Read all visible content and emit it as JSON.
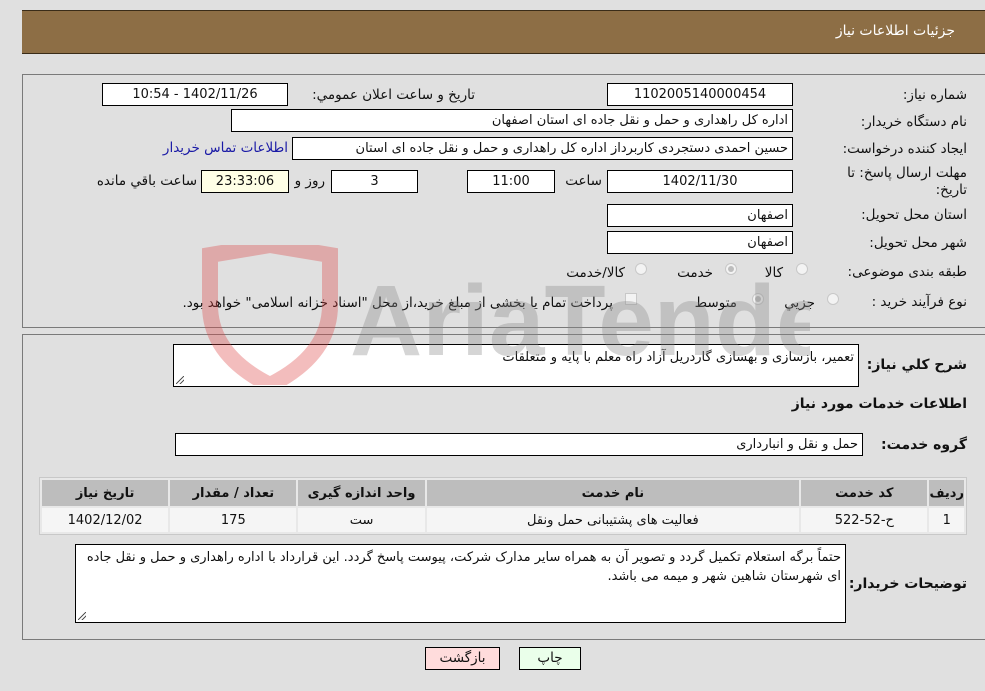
{
  "header": {
    "title": "جزئیات اطلاعات نیاز"
  },
  "info": {
    "need_number": {
      "label": "شماره نیاز:",
      "value": "1102005140000454"
    },
    "announce": {
      "label": "تاریخ و ساعت اعلان عمومي:",
      "value": "1402/11/26 - 10:54"
    },
    "buyer_org": {
      "label": "نام دستگاه خریدار:",
      "value": "اداره کل راهداری و حمل و نقل جاده ای استان اصفهان"
    },
    "creator": {
      "label": "ایجاد کننده درخواست:",
      "value": "حسین احمدی دستجردی کاربرداز اداره کل راهداری و حمل و نقل جاده ای استان",
      "contact_link": "اطلاعات تماس خریدار"
    },
    "deadline": {
      "label": "مهلت ارسال پاسخ: تا تاریخ:",
      "date": "1402/11/30",
      "time_label": "ساعت",
      "time": "11:00",
      "days": "3",
      "days_label": "روز و",
      "remaining": "23:33:06",
      "remaining_label": "ساعت باقي مانده"
    },
    "province": {
      "label": "استان محل تحویل:",
      "value": "اصفهان"
    },
    "city": {
      "label": "شهر محل تحویل:",
      "value": "اصفهان"
    },
    "category": {
      "label": "طبقه بندی موضوعی:",
      "options": [
        {
          "label": "کالا",
          "selected": false
        },
        {
          "label": "خدمت",
          "selected": true
        },
        {
          "label": "کالا/خدمت",
          "selected": false
        }
      ]
    },
    "process": {
      "label": "نوع فرآیند خرید :",
      "options": [
        {
          "label": "جزيي",
          "selected": false
        },
        {
          "label": "متوسط",
          "selected": true
        }
      ],
      "treasury_note": "پرداخت تمام یا بخشی از مبلغ خرید،از محل \"اسناد خزانه اسلامی\" خواهد بود.",
      "treasury_checked": false
    }
  },
  "details": {
    "description_label": "شرح کلي نیاز:",
    "description": "تعمیر، بازسازی و بهسازی گاردریل آزاد راه معلم با پایه و متعلقات",
    "services_title": "اطلاعات خدمات مورد نیاز",
    "service_group_label": "گروه خدمت:",
    "service_group": "حمل و نقل و انبارداری",
    "table": {
      "headers": [
        "ردیف",
        "کد خدمت",
        "نام خدمت",
        "واحد اندازه گیری",
        "تعداد / مقدار",
        "تاریخ نیاز"
      ],
      "rows": [
        [
          "1",
          "ح-52-522",
          "فعالیت های پشتیبانی حمل ونقل",
          "ست",
          "175",
          "1402/12/02"
        ]
      ]
    },
    "buyer_notes_label": "توضیحات خریدار:",
    "buyer_notes": "حتماً برگه استعلام تکمیل گردد و تصویر آن به همراه سایر مدارک شرکت، پیوست پاسخ گردد. این قرارداد با اداره راهداری و حمل و نقل جاده ای شهرستان شاهین شهر و میمه می باشد."
  },
  "buttons": {
    "print": "چاپ",
    "back": "بازگشت"
  },
  "watermark": {
    "text": "AriaTender.neT"
  }
}
